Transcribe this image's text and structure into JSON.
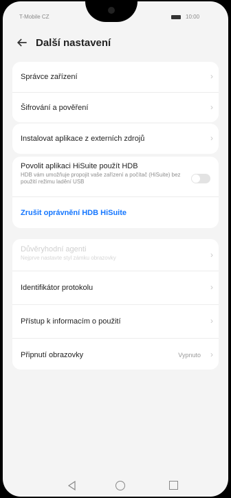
{
  "status": {
    "carrier": "T-Mobile CZ",
    "time": "10:00"
  },
  "header": {
    "title": "Další nastavení"
  },
  "items": [
    {
      "label": "Správce zařízení"
    },
    {
      "label": "Šifrování a pověření"
    },
    {
      "label": "Instalovat aplikace z externích zdrojů"
    },
    {
      "label": "Povolit aplikaci HiSuite použít HDB",
      "subtitle": "HDB vám umožňuje propojit vaše zařízení a počítač (HiSuite) bez použití režimu ladění USB",
      "toggle": false
    },
    {
      "label": "Zrušit oprávnění HDB HiSuite"
    },
    {
      "label": "Důvěryhodní agenti",
      "subtitle": "Nejprve nastavte styl zámku obrazovky",
      "disabled": true
    },
    {
      "label": "Identifikátor protokolu"
    },
    {
      "label": "Přístup k informacím o použití"
    },
    {
      "label": "Připnutí obrazovky",
      "value": "Vypnuto"
    }
  ]
}
